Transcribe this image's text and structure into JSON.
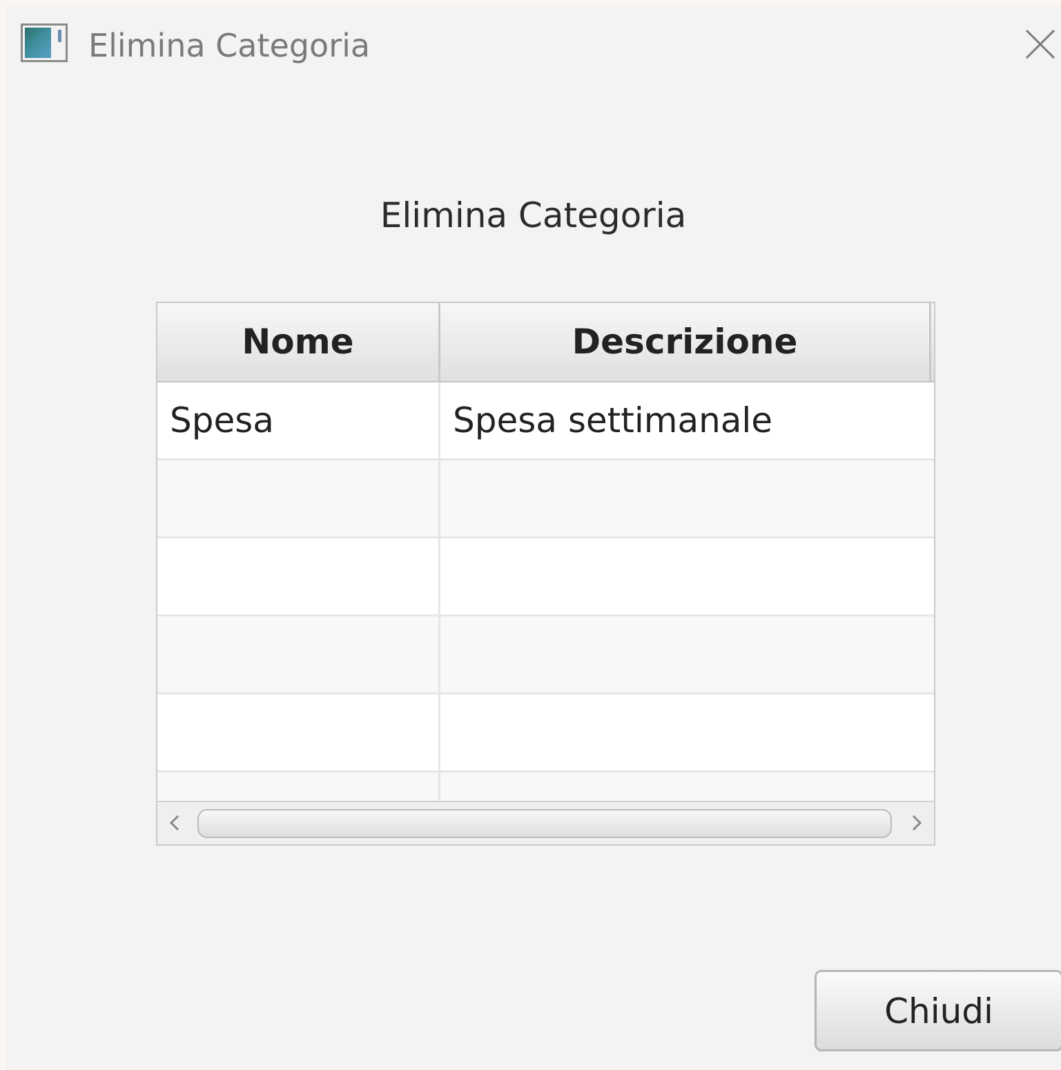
{
  "window": {
    "title": "Elimina Categoria"
  },
  "dialog": {
    "heading": "Elimina Categoria"
  },
  "table": {
    "columns": [
      "Nome",
      "Descrizione"
    ],
    "rows": [
      [
        "Spesa",
        "Spesa settimanale"
      ],
      [
        "",
        ""
      ],
      [
        "",
        ""
      ],
      [
        "",
        ""
      ],
      [
        "",
        ""
      ],
      [
        "",
        ""
      ]
    ]
  },
  "buttons": {
    "close_label": "Chiudi"
  },
  "icons": {
    "app": "app-window-icon",
    "close": "close-icon",
    "scroll_left": "chevron-left-icon",
    "scroll_right": "chevron-right-icon"
  }
}
